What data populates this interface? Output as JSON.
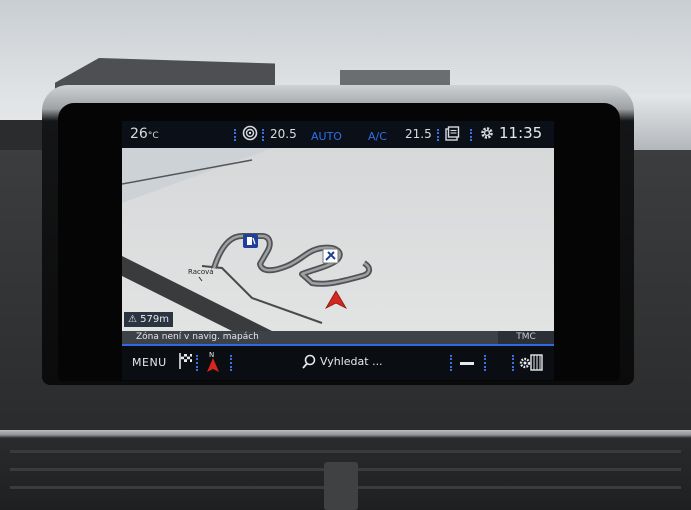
{
  "status_bar": {
    "outside_temp_value": "26",
    "outside_temp_unit": "°C",
    "fan_icon": "fan-icon",
    "temp_left": "20.5",
    "auto_label": "AUTO",
    "ac_label": "A/C",
    "temp_right": "21.5",
    "clock": "11:35",
    "accent_color": "#2f6fe8"
  },
  "map": {
    "place_label": "Racová",
    "scale": "579m",
    "poi_icons": [
      "fuel-station-icon",
      "car-service-icon"
    ],
    "position_marker": "vehicle-arrow-icon"
  },
  "info_bar": {
    "message": "Zóna není v navig. mapách",
    "tmc_label": "TMC"
  },
  "toolbar": {
    "menu_label": "MENU",
    "compass_north": "N",
    "search_label": "Vyhledat ..."
  }
}
